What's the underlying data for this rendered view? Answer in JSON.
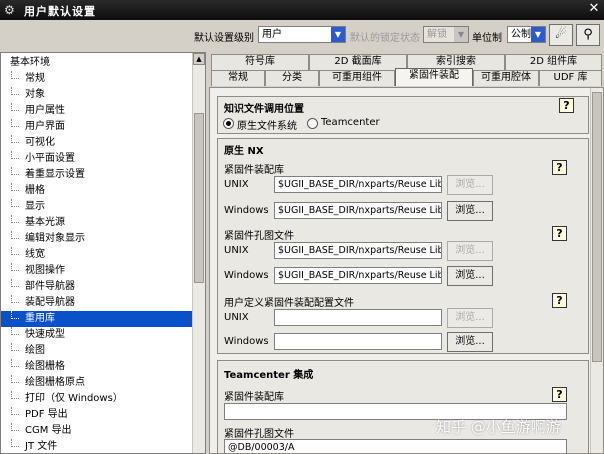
{
  "window": {
    "title": "用户默认设置",
    "close_symbol": "✕",
    "app_icon_symbol": "⚙"
  },
  "toolbar": {
    "level_label": "默认设置级别",
    "level_value": "用户",
    "lock_label": "默认的锁定状态",
    "lock_value": "解锁",
    "unit_label": "单位制",
    "unit_value": "公制",
    "button1_icon": "☄",
    "button2_icon": "⚲"
  },
  "tree": {
    "root": "基本环境",
    "items": [
      "常规",
      "对象",
      "用户属性",
      "用户界面",
      "可视化",
      "小平面设置",
      "着重显示设置",
      "栅格",
      "显示",
      "基本光源",
      "编辑对象显示",
      "线宽",
      "视图操作",
      "部件导航器",
      "装配导航器",
      "重用库",
      "快速成型",
      "绘图",
      "绘图栅格",
      "绘图栅格原点",
      "打印（仅 Windows）",
      "PDF 导出",
      "CGM 导出",
      "JT 文件"
    ],
    "selected": "重用库"
  },
  "tabs": {
    "row1": [
      "符号库",
      "2D 截面库",
      "索引搜索",
      "2D 组件库"
    ],
    "row2": [
      "常规",
      "分类",
      "可重用组件",
      "紧固件装配",
      "可重用腔体",
      "UDF 库"
    ],
    "active": "紧固件装配"
  },
  "location": {
    "title": "知识文件调用位置",
    "option_native": "原生文件系统",
    "option_teamcenter": "Teamcenter",
    "selected": "原生文件系统"
  },
  "native": {
    "title": "原生 NX",
    "fastener_lib": {
      "label": "紧固件装配库",
      "unix_label": "UNIX",
      "unix_value": "$UGII_BASE_DIR/nxparts/Reuse Lib",
      "windows_label": "Windows",
      "windows_value": "$UGII_BASE_DIR/nxparts/Reuse Lib"
    },
    "hole_file": {
      "label": "紧固件孔图文件",
      "unix_label": "UNIX",
      "unix_value": "$UGII_BASE_DIR/nxparts/Reuse Lib",
      "windows_label": "Windows",
      "windows_value": "$UGII_BASE_DIR/nxparts/Reuse Lib"
    },
    "user_config": {
      "label": "用户定义紧固件装配配置文件",
      "unix_label": "UNIX",
      "unix_value": "",
      "windows_label": "Windows",
      "windows_value": ""
    },
    "browse_label": "浏览..."
  },
  "teamcenter": {
    "title": "Teamcenter 集成",
    "fastener_lib_label": "紧固件装配库",
    "fastener_lib_value": "",
    "hole_file_label": "紧固件孔图文件",
    "hole_file_value": "@DB/00003/A"
  },
  "help_symbol": "?",
  "watermark": "知乎 @小鱼游啊游"
}
